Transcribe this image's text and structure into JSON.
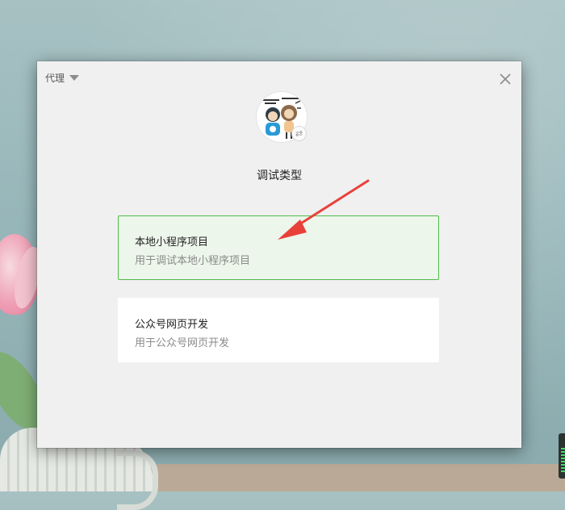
{
  "dialog": {
    "proxy_label": "代理",
    "close_icon": "close-icon",
    "title": "调试类型",
    "avatar_icon": "user-avatar",
    "avatar_badge_glyph": "⇄"
  },
  "options": [
    {
      "title": "本地小程序项目",
      "description": "用于调试本地小程序项目",
      "selected": true
    },
    {
      "title": "公众号网页开发",
      "description": "用于公众号网页开发",
      "selected": false
    }
  ],
  "colors": {
    "selected_border": "#4fbb4a",
    "selected_bg": "#ecf6ea",
    "annotation_arrow": "#e8413a"
  }
}
